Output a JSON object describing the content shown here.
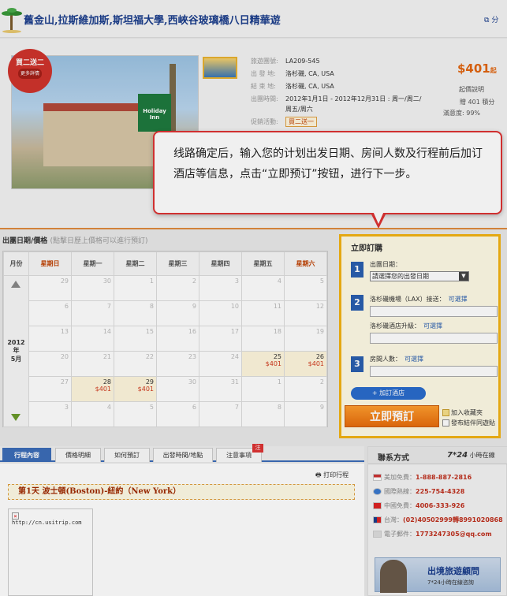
{
  "header": {
    "title": "舊金山,拉斯維加斯,斯坦福大學,西峽谷玻璃橋八日精華遊",
    "share_label": "分"
  },
  "product": {
    "promo_badge": {
      "main": "買二送二",
      "sub": "更多詳情"
    },
    "hotel_sign": "Holiday Inn",
    "info": [
      {
        "label": "旅遊團號:",
        "value": "LA209-545"
      },
      {
        "label": "出 發 地:",
        "value": "洛杉磯, CA, USA"
      },
      {
        "label": "結 束 地:",
        "value": "洛杉磯, CA, USA"
      },
      {
        "label": "出團時間:",
        "value": "2012年1月1日 - 2012年12月31日 : 周一/周二/"
      },
      {
        "label": "",
        "value": "周五/周六"
      },
      {
        "label": "促銷活動:",
        "value": "買二送一"
      }
    ],
    "price": "$401",
    "price_suffix": "起",
    "price_note": "起價說明",
    "points": "贈 401 積分",
    "satisfaction": "滿意度: 99%"
  },
  "tooltip": {
    "text": "线路确定后，输入您的计划出发日期、房间人数及行程前后加订酒店等信息，点击“立即预订”按钮，进行下一步。"
  },
  "calendar": {
    "heading": "出團日期/價格",
    "hint": "(點擊日歷上價格可以進行預訂)",
    "month_header": "月份",
    "weekdays": [
      "星期日",
      "星期一",
      "星期二",
      "星期三",
      "星期四",
      "星期五",
      "星期六"
    ],
    "year_label": "2012年",
    "month_label": "5月",
    "weeks": [
      [
        {
          "d": "29"
        },
        {
          "d": "30"
        },
        {
          "d": "1"
        },
        {
          "d": "2"
        },
        {
          "d": "3"
        },
        {
          "d": "4"
        },
        {
          "d": "5"
        }
      ],
      [
        {
          "d": "6"
        },
        {
          "d": "7"
        },
        {
          "d": "8"
        },
        {
          "d": "9"
        },
        {
          "d": "10"
        },
        {
          "d": "11"
        },
        {
          "d": "12"
        }
      ],
      [
        {
          "d": "13"
        },
        {
          "d": "14"
        },
        {
          "d": "15"
        },
        {
          "d": "16"
        },
        {
          "d": "17"
        },
        {
          "d": "18"
        },
        {
          "d": "19"
        }
      ],
      [
        {
          "d": "20"
        },
        {
          "d": "21"
        },
        {
          "d": "22"
        },
        {
          "d": "23"
        },
        {
          "d": "24"
        },
        {
          "d": "25",
          "p": "$401"
        },
        {
          "d": "26",
          "p": "$401"
        }
      ],
      [
        {
          "d": "27"
        },
        {
          "d": "28",
          "p": "$401"
        },
        {
          "d": "29",
          "p": "$401"
        },
        {
          "d": "30"
        },
        {
          "d": "31"
        },
        {
          "d": "1"
        },
        {
          "d": "2"
        }
      ],
      [
        {
          "d": "3"
        },
        {
          "d": "4"
        },
        {
          "d": "5"
        },
        {
          "d": "6"
        },
        {
          "d": "7"
        },
        {
          "d": "8"
        },
        {
          "d": "9"
        }
      ]
    ]
  },
  "booking": {
    "title": "立即訂購",
    "step1_label": "出團日期：",
    "date_select": "請選擇您的出發日期",
    "step2_label": "洛杉磯機場（LAX）接送：",
    "step2_link": "可選擇",
    "hotel_upgrade_label": "洛杉磯酒店升級：",
    "hotel_upgrade_link": "可選擇",
    "step3_label": "房間人數：",
    "step3_link": "可選擇",
    "add_hotel": "+ 加訂酒店",
    "book_now": "立即預訂",
    "favorite": "加入收藏夾",
    "post_note": "發布結伴同遊貼"
  },
  "tabs": [
    "行程內容",
    "價格明細",
    "如何預訂",
    "出發時間/地點",
    "注意事項"
  ],
  "tab_new_badge": "注",
  "itinerary": {
    "print_label": "打印行程",
    "day1": "第1天  波士頓(Boston)-紐約（New York）",
    "broken_img_url": "http://cn.usitrip.com"
  },
  "contact": {
    "title": "聯系方式",
    "hours_prefix": "7*24",
    "hours_suffix": "小時在線",
    "rows": [
      {
        "label": "美加免費：",
        "value": "1-888-887-2816"
      },
      {
        "label": "國際熱線：",
        "value": "225-754-4328"
      },
      {
        "label": "中國免費：",
        "value": "4006-333-926"
      },
      {
        "label": "台灣：",
        "value": "(02)40502999轉8991020868"
      },
      {
        "label": "電子郵件：",
        "value": "1773247305@qq.com"
      }
    ],
    "advisor_title": "出境旅遊顧問",
    "advisor_sub": "7*24小時在線咨詢"
  },
  "colors": {
    "accent_blue": "#2a5fb0",
    "accent_orange": "#e86d0c",
    "tooltip_border": "#d33",
    "price_red": "#d23a1e"
  }
}
